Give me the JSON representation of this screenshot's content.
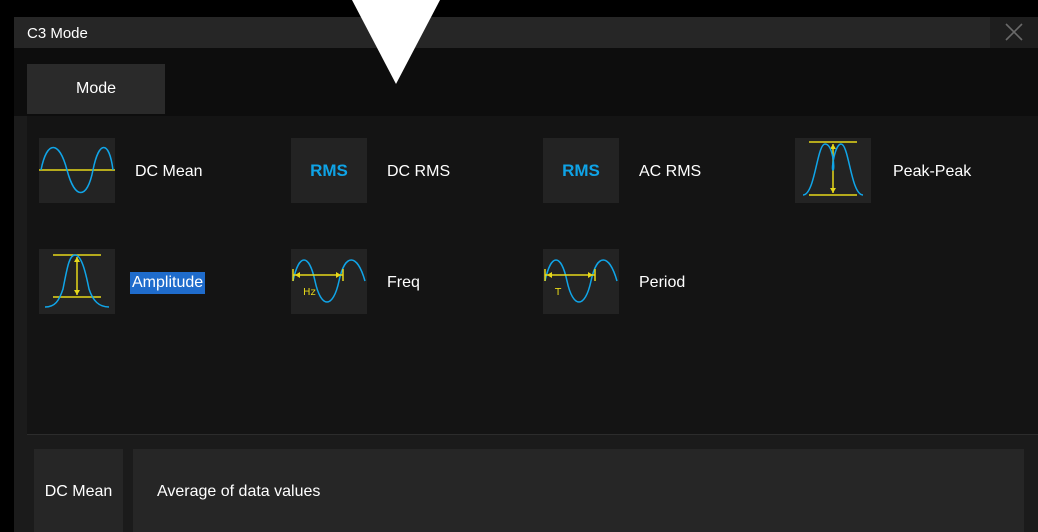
{
  "window": {
    "title": "C3 Mode"
  },
  "tabs": [
    {
      "label": "Mode"
    }
  ],
  "options": [
    {
      "label": "DC Mean",
      "icon": "sine-mean-icon"
    },
    {
      "label": "DC RMS",
      "icon": "rms-icon",
      "icon_text": "RMS"
    },
    {
      "label": "AC RMS",
      "icon": "rms-icon",
      "icon_text": "RMS"
    },
    {
      "label": "Peak-Peak",
      "icon": "peak-peak-icon"
    },
    {
      "label": "Amplitude",
      "icon": "amplitude-icon",
      "selected": true
    },
    {
      "label": "Freq",
      "icon": "freq-icon",
      "icon_text": "Hz"
    },
    {
      "label": "Period",
      "icon": "period-icon",
      "icon_text": "T"
    }
  ],
  "description": {
    "name": "DC Mean",
    "text": "Average of data values"
  },
  "colors": {
    "accent": "#1f6ccc",
    "wave": "#10a5e8",
    "marker": "#e6d81a",
    "rms": "#0fa3e6"
  }
}
